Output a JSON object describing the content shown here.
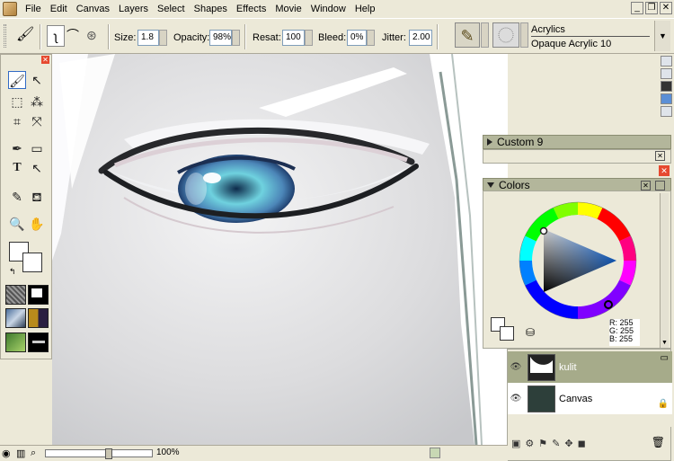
{
  "menu": [
    "File",
    "Edit",
    "Canvas",
    "Layers",
    "Select",
    "Shapes",
    "Effects",
    "Movie",
    "Window",
    "Help"
  ],
  "window_controls": [
    "_",
    "❐",
    "✕"
  ],
  "properties": {
    "size_label": "Size:",
    "size_value": "1.8",
    "opacity_label": "Opacity:",
    "opacity_value": "98%",
    "resat_label": "Resat:",
    "resat_value": "100",
    "bleed_label": "Bleed:",
    "bleed_value": "0%",
    "jitter_label": "Jitter:",
    "jitter_value": "2.00",
    "brush_category": "Acrylics",
    "brush_variant": "Opaque Acrylic 10"
  },
  "panels": {
    "custom_title": "Custom  9",
    "colors_title": "Colors",
    "rgb": {
      "r": "R: 255",
      "g": "G: 255",
      "b": "B: 255"
    }
  },
  "layers": [
    {
      "name": "kulit",
      "selected": true
    },
    {
      "name": "Canvas",
      "selected": false
    }
  ],
  "status": {
    "zoom": "100%"
  },
  "colors": {
    "panel_header": "#b3b69b",
    "selection": "#316ac5"
  }
}
